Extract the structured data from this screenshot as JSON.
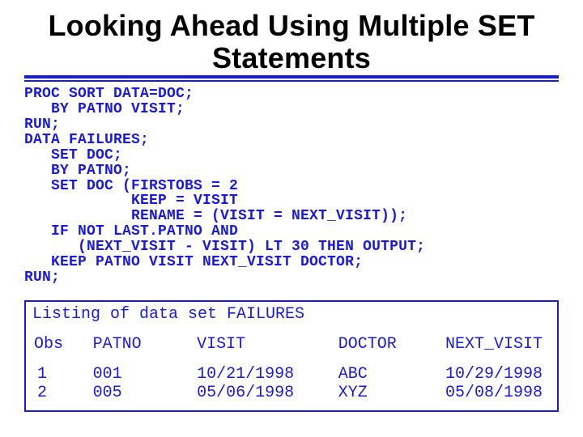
{
  "title": "Looking Ahead Using Multiple SET Statements",
  "code": "PROC SORT DATA=DOC;\n   BY PATNO VISIT;\nRUN;\nDATA FAILURES;\n   SET DOC;\n   BY PATNO;\n   SET DOC (FIRSTOBS = 2\n            KEEP = VISIT\n            RENAME = (VISIT = NEXT_VISIT));\n   IF NOT LAST.PATNO AND\n      (NEXT_VISIT - VISIT) LT 30 THEN OUTPUT;\n   KEEP PATNO VISIT NEXT_VISIT DOCTOR;\nRUN;",
  "listing": {
    "title": "Listing of data set FAILURES",
    "headers": {
      "obs": "Obs",
      "patno": "PATNO",
      "visit": "VISIT",
      "doctor": "DOCTOR",
      "next_visit": "NEXT_VISIT"
    },
    "rows": [
      {
        "obs": "1",
        "patno": "001",
        "visit": "10/21/1998",
        "doctor": "ABC",
        "next_visit": "10/29/1998"
      },
      {
        "obs": "2",
        "patno": "005",
        "visit": "05/06/1998",
        "doctor": "XYZ",
        "next_visit": "05/08/1998"
      }
    ]
  }
}
